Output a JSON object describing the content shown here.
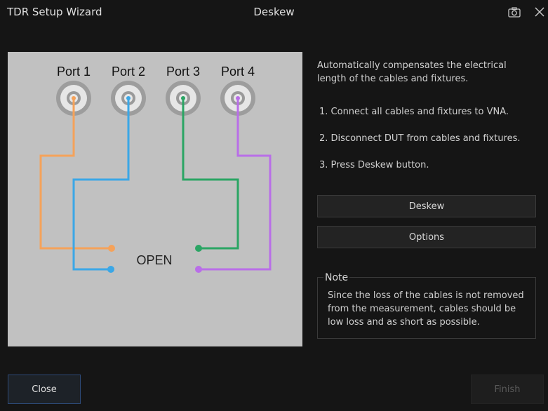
{
  "header": {
    "app_title": "TDR Setup Wizard",
    "page_title": "Deskew",
    "camera_icon": "camera-icon",
    "close_icon": "close-icon"
  },
  "diagram": {
    "ports": [
      "Port 1",
      "Port 2",
      "Port 3",
      "Port 4"
    ],
    "open_label": "OPEN",
    "colors": {
      "port1": "#f5a25a",
      "port2": "#3ba7e6",
      "port3": "#2aa564",
      "port4": "#b96ee8",
      "background": "#c1c1c1"
    }
  },
  "instructions": {
    "description": "Automatically compensates the electrical length of the cables and fixtures.",
    "steps": [
      "1. Connect all cables and fixtures to VNA.",
      "2. Disconnect DUT from cables and fixtures.",
      "3. Press Deskew button."
    ]
  },
  "buttons": {
    "deskew": "Deskew",
    "options": "Options",
    "close": "Close",
    "finish": "Finish"
  },
  "note": {
    "title": "Note",
    "text": "Since the loss of the cables is not removed from the measurement, cables should be low loss and as short as possible."
  }
}
